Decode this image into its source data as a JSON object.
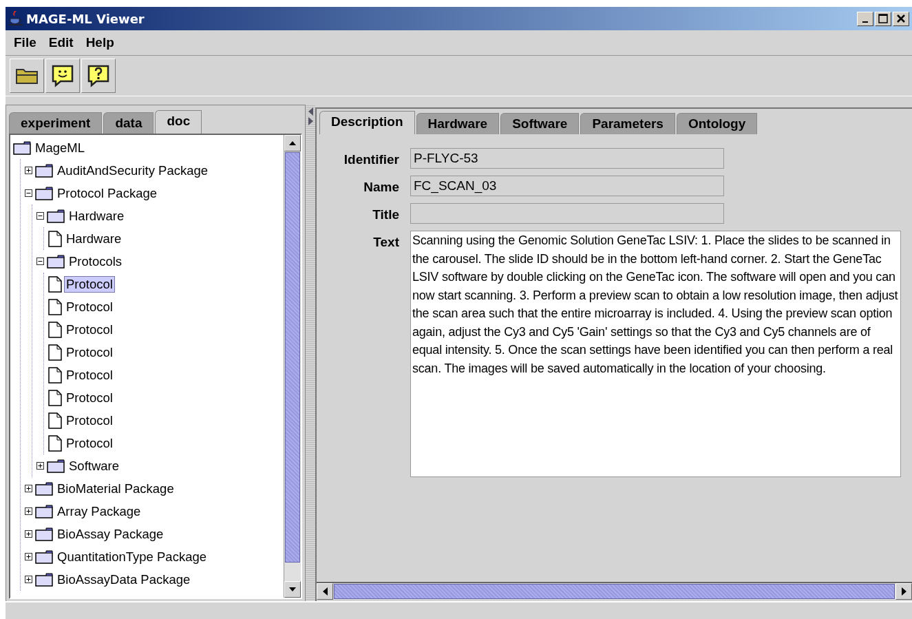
{
  "window": {
    "title": "MAGE-ML Viewer"
  },
  "menu": [
    "File",
    "Edit",
    "Help"
  ],
  "toolbar": [
    {
      "kind": "open"
    },
    {
      "kind": "smiley"
    },
    {
      "kind": "help"
    }
  ],
  "left_tabs": [
    {
      "label": "experiment",
      "selected": false
    },
    {
      "label": "data",
      "selected": false
    },
    {
      "label": "doc",
      "selected": true
    }
  ],
  "tree": [
    {
      "label": "MageML",
      "kind": "folder",
      "selected": false,
      "children": [
        {
          "label": "AuditAndSecurity Package",
          "kind": "folder",
          "expanded": false,
          "selected": false
        },
        {
          "label": "Protocol Package",
          "kind": "folder",
          "expanded": true,
          "selected": false,
          "children": [
            {
              "label": "Hardware",
              "kind": "folder",
              "expanded": true,
              "selected": false,
              "children": [
                {
                  "label": "Hardware",
                  "kind": "document",
                  "selected": false
                }
              ]
            },
            {
              "label": "Protocols",
              "kind": "folder",
              "expanded": true,
              "selected": false,
              "children": [
                {
                  "label": "Protocol",
                  "kind": "document",
                  "selected": true
                },
                {
                  "label": "Protocol",
                  "kind": "document",
                  "selected": false
                },
                {
                  "label": "Protocol",
                  "kind": "document",
                  "selected": false
                },
                {
                  "label": "Protocol",
                  "kind": "document",
                  "selected": false
                },
                {
                  "label": "Protocol",
                  "kind": "document",
                  "selected": false
                },
                {
                  "label": "Protocol",
                  "kind": "document",
                  "selected": false
                },
                {
                  "label": "Protocol",
                  "kind": "document",
                  "selected": false
                },
                {
                  "label": "Protocol",
                  "kind": "document",
                  "selected": false
                }
              ]
            },
            {
              "label": "Software",
              "kind": "folder",
              "expanded": false,
              "selected": false
            }
          ]
        },
        {
          "label": "BioMaterial Package",
          "kind": "folder",
          "expanded": false,
          "selected": false
        },
        {
          "label": "Array Package",
          "kind": "folder",
          "expanded": false,
          "selected": false
        },
        {
          "label": "BioAssay Package",
          "kind": "folder",
          "expanded": false,
          "selected": false
        },
        {
          "label": "QuantitationType Package",
          "kind": "folder",
          "expanded": false,
          "selected": false
        },
        {
          "label": "BioAssayData Package",
          "kind": "folder",
          "expanded": false,
          "selected": false
        }
      ]
    }
  ],
  "right_tabs": [
    {
      "label": "Description",
      "selected": true
    },
    {
      "label": "Hardware",
      "selected": false
    },
    {
      "label": "Software",
      "selected": false
    },
    {
      "label": "Parameters",
      "selected": false
    },
    {
      "label": "Ontology",
      "selected": false
    }
  ],
  "fields": [
    {
      "label": "Identifier",
      "value": "P-FLYC-53",
      "kind": "line"
    },
    {
      "label": "Name",
      "value": "FC_SCAN_03",
      "kind": "line"
    },
    {
      "label": "Title",
      "kind": "line"
    },
    {
      "label": "Text",
      "kind": "area",
      "value": "Scanning using the Genomic Solution GeneTac LSIV: 1. Place the slides to be scanned in the carousel. The slide ID should be in the bottom left-hand corner. 2. Start the GeneTac LSIV software by double clicking on the GeneTac icon. The software will open and you can now start scanning. 3. Perform a preview scan to obtain a low resolution image, then adjust the scan area such that the entire microarray is included. 4. Using the preview scan option again, adjust the Cy3 and Cy5 'Gain' settings so that the Cy3 and Cy5 channels are of equal intensity. 5. Once the scan settings have been identified you can then perform a real scan. The images will be saved automatically in the location of your choosing."
    }
  ]
}
